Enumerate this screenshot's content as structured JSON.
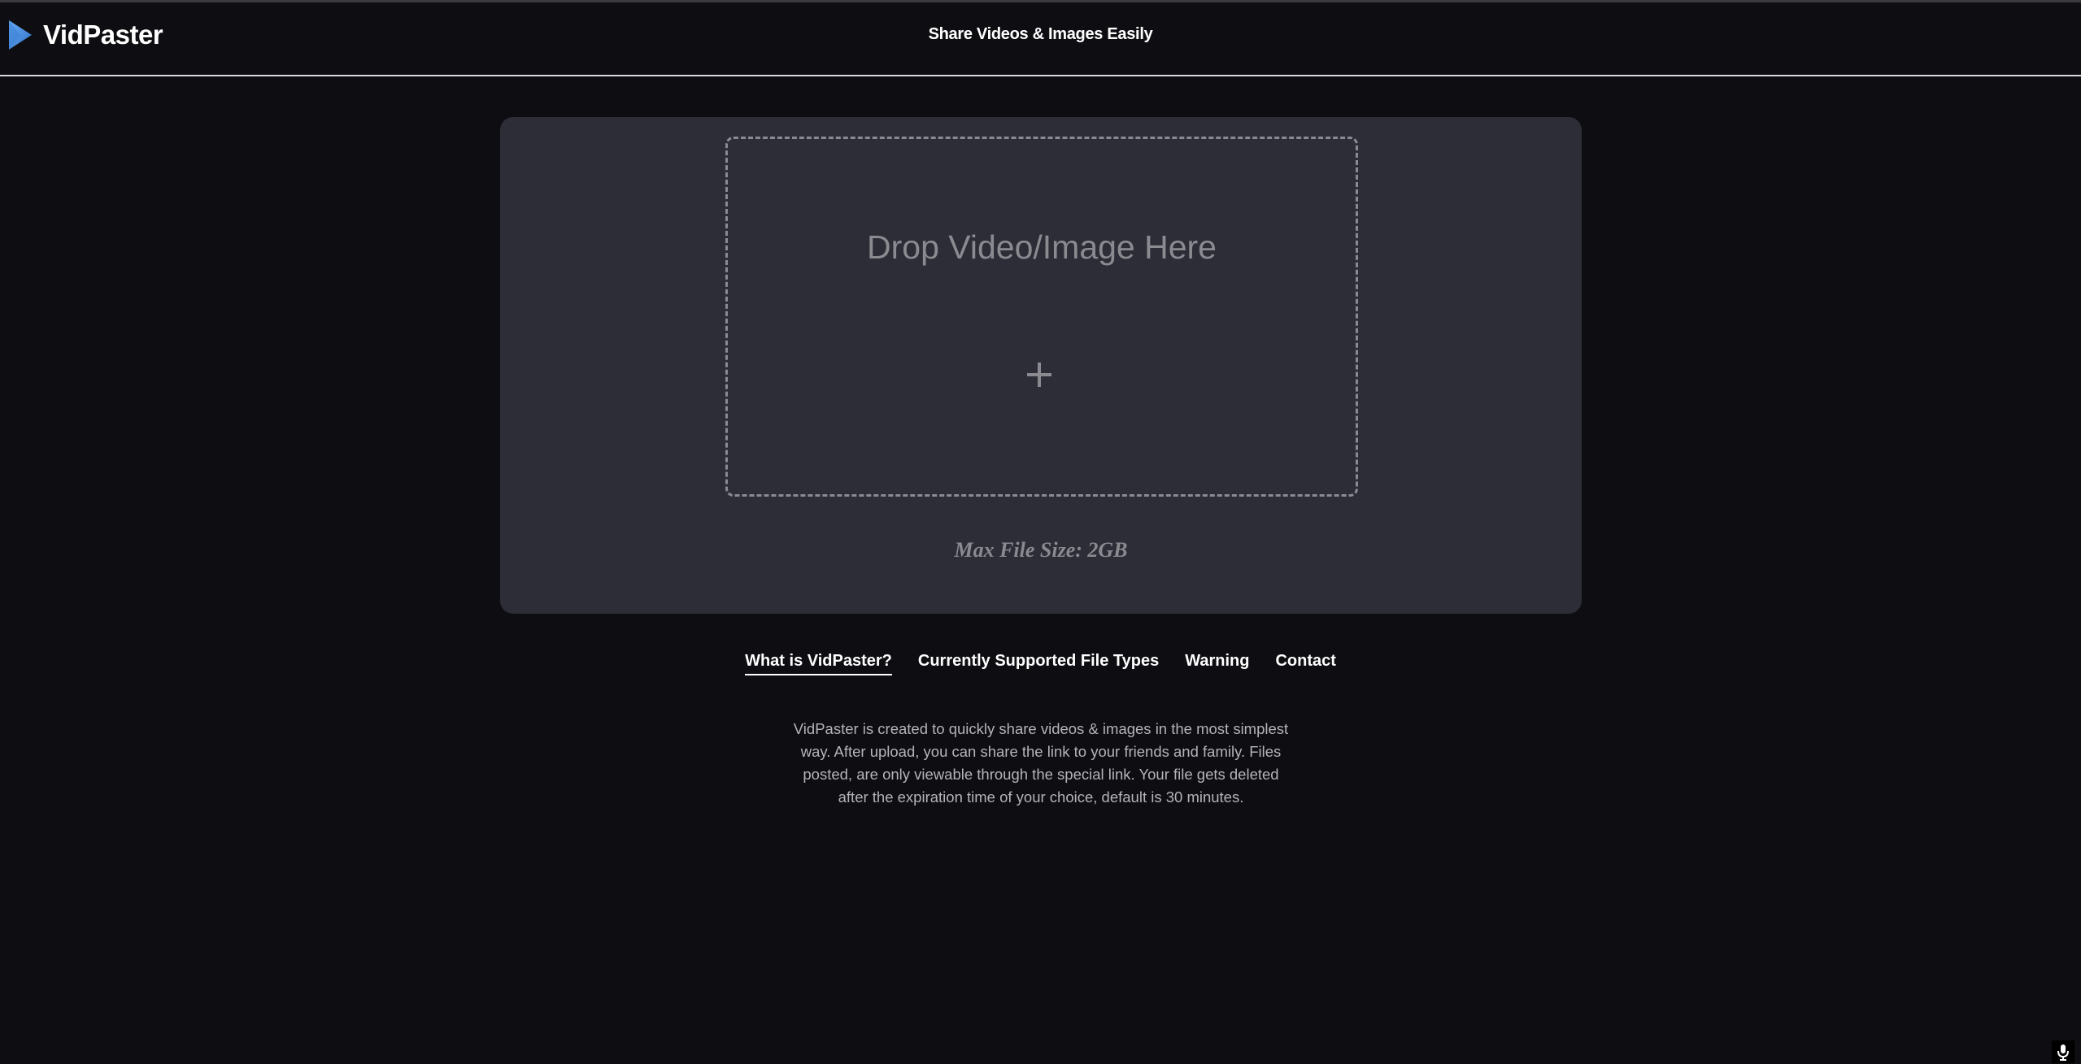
{
  "header": {
    "brand": "VidPaster",
    "tagline": "Share Videos & Images Easily",
    "logo_icon": "play-triangle-icon",
    "accent_color": "#4a90e2"
  },
  "upload": {
    "drop_label": "Drop Video/Image Here",
    "plus_icon": "plus-icon",
    "max_size_text": "Max File Size: 2GB"
  },
  "tabs": [
    {
      "label": "What is VidPaster?",
      "active": true
    },
    {
      "label": "Currently Supported File Types",
      "active": false
    },
    {
      "label": "Warning",
      "active": false
    },
    {
      "label": "Contact",
      "active": false
    }
  ],
  "description": "VidPaster is created to quickly share videos & images in the most simplest way. After upload, you can share the link to your friends and family. Files posted, are only viewable through the special link. Your file gets deleted after the expiration time of your choice, default is 30 minutes.",
  "corner": {
    "icon": "microphone-icon"
  }
}
